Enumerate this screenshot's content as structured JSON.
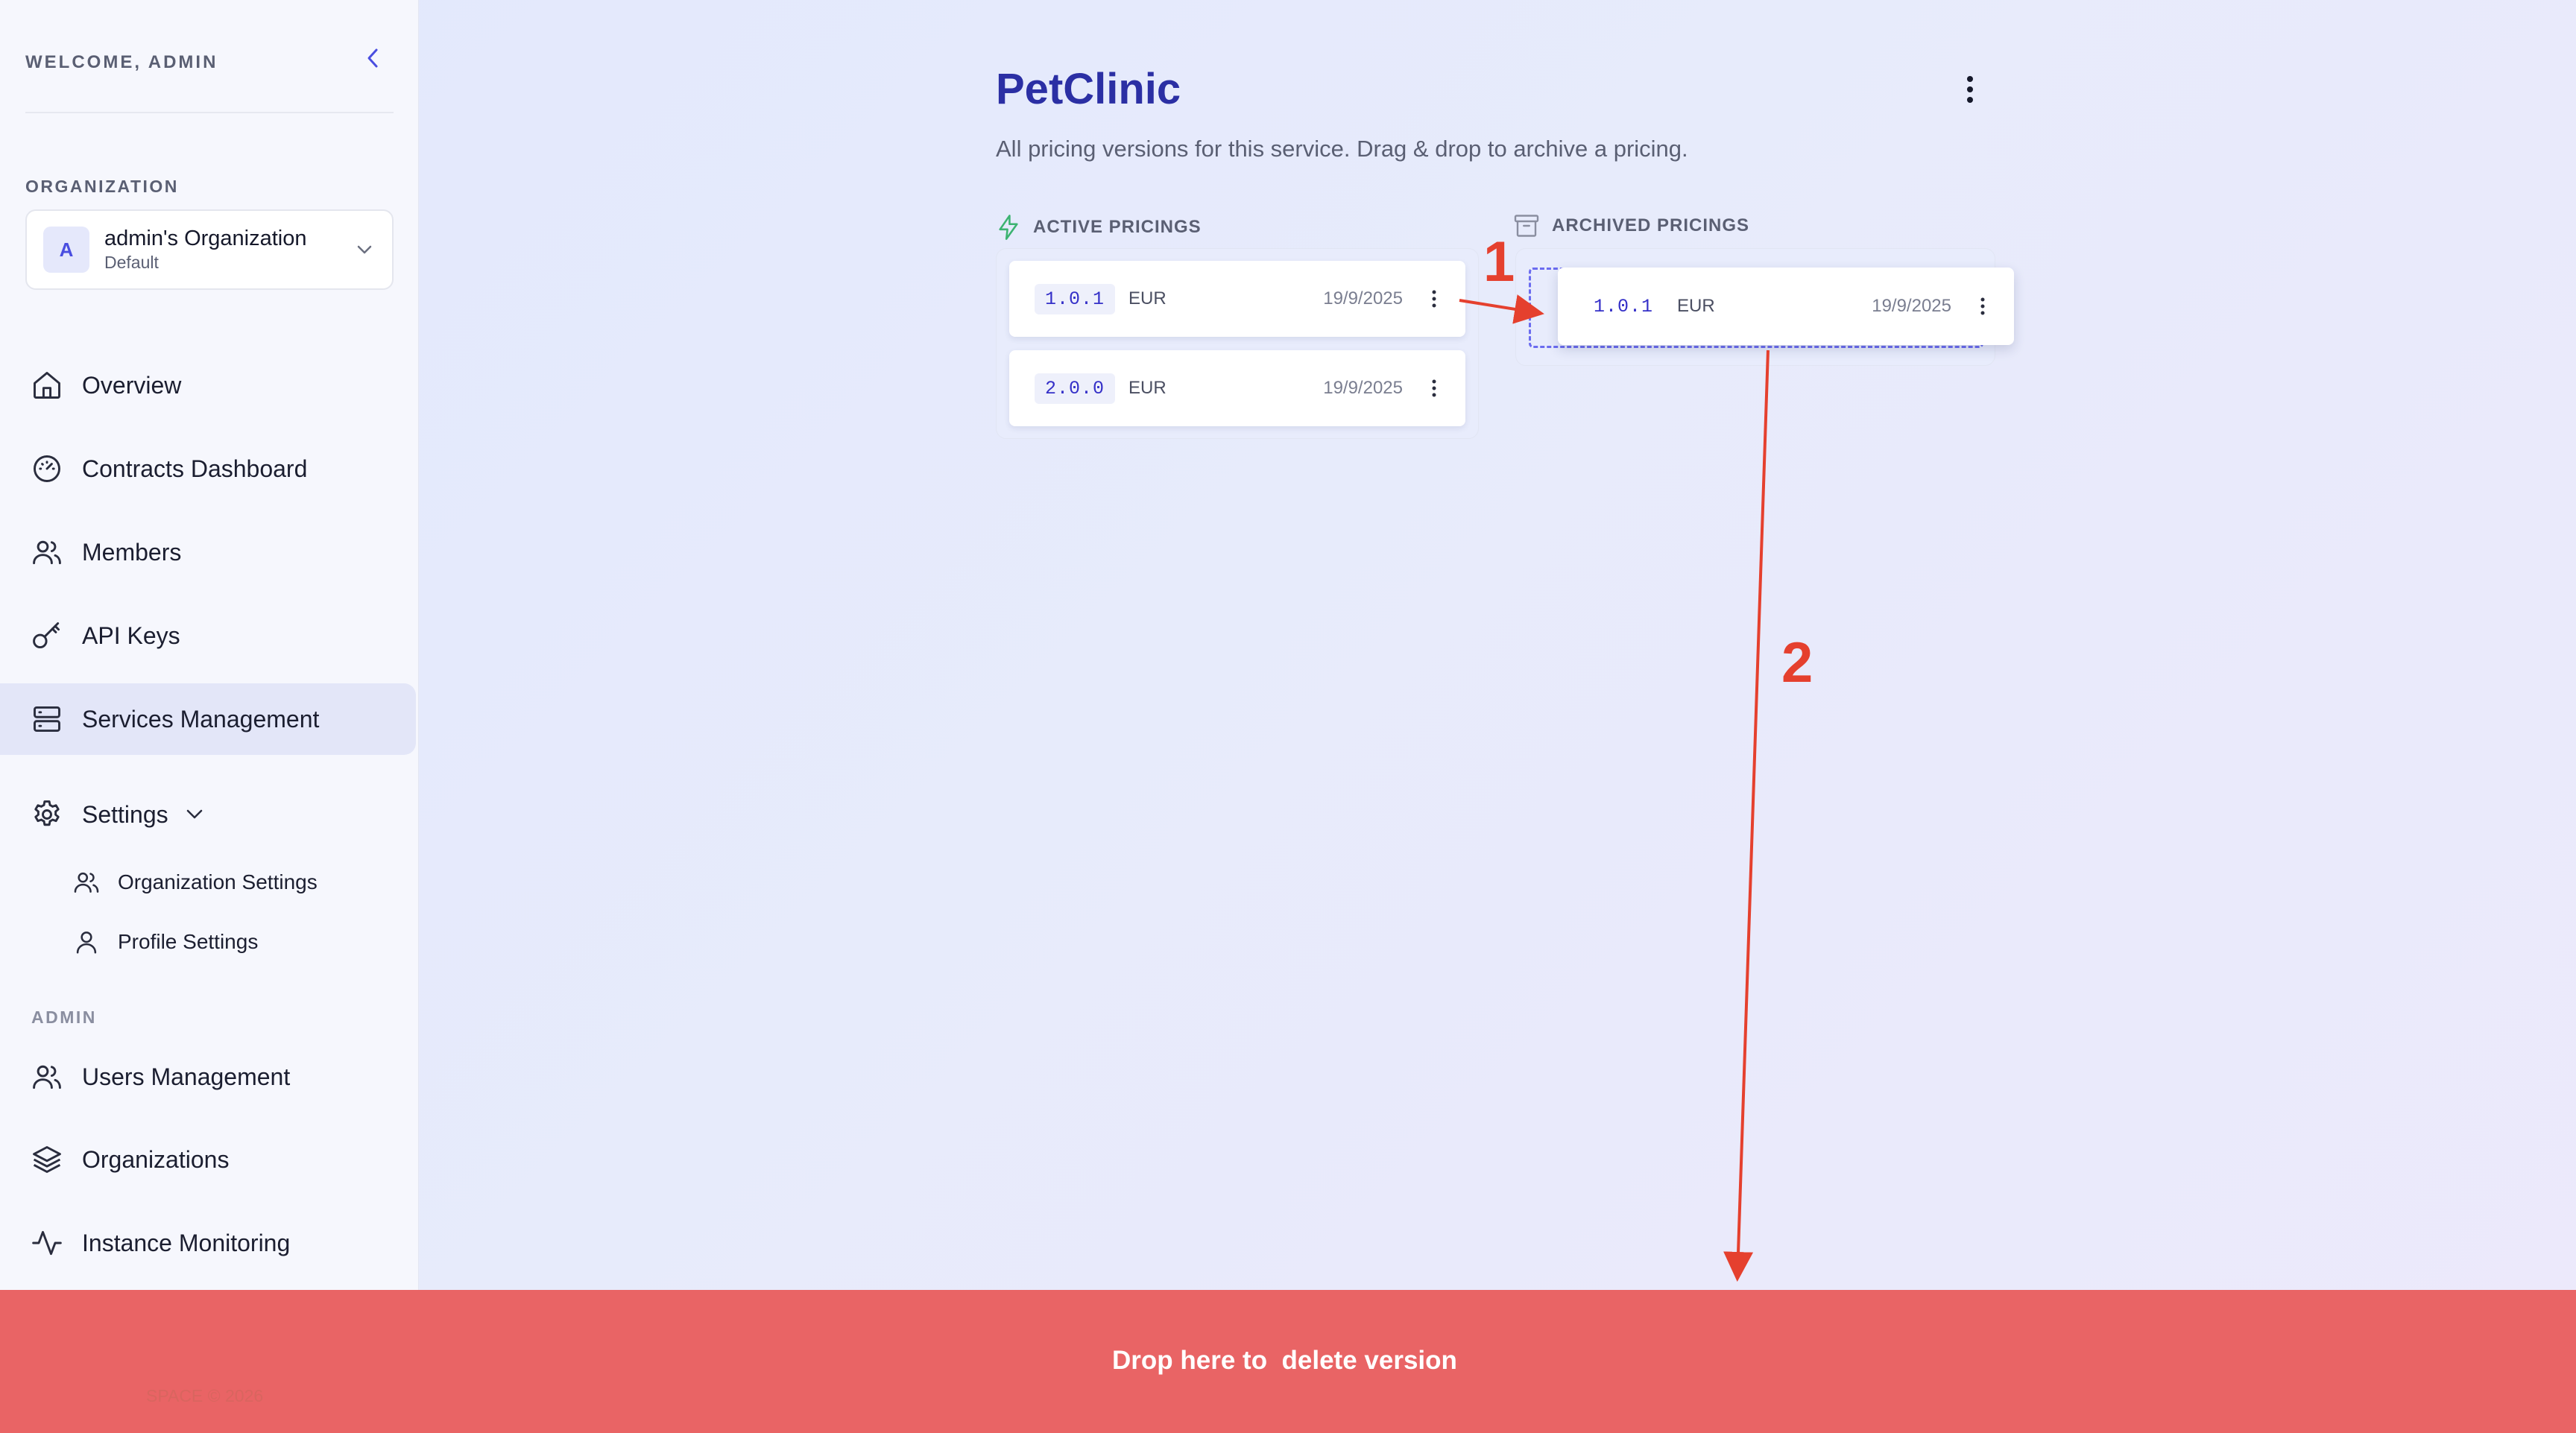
{
  "sidebar": {
    "welcome": "WELCOME, ADMIN",
    "organization_label": "ORGANIZATION",
    "organization": {
      "avatar": "A",
      "name": "admin's Organization",
      "subtitle": "Default"
    },
    "nav": [
      {
        "label": "Overview",
        "icon": "home-icon"
      },
      {
        "label": "Contracts Dashboard",
        "icon": "gauge-icon"
      },
      {
        "label": "Members",
        "icon": "users-icon"
      },
      {
        "label": "API Keys",
        "icon": "key-icon"
      },
      {
        "label": "Services Management",
        "icon": "server-icon",
        "active": true
      },
      {
        "label": "Settings",
        "icon": "gear-icon"
      }
    ],
    "settings_sub": [
      {
        "label": "Organization Settings",
        "icon": "users-icon"
      },
      {
        "label": "Profile Settings",
        "icon": "user-icon"
      }
    ],
    "admin_label": "ADMIN",
    "admin_nav": [
      {
        "label": "Users Management",
        "icon": "users-icon"
      },
      {
        "label": "Organizations",
        "icon": "layers-icon"
      },
      {
        "label": "Instance Monitoring",
        "icon": "activity-icon"
      }
    ],
    "footer": "SPACE © 2026"
  },
  "main": {
    "title": "PetClinic",
    "subtitle": "All pricing versions for this service. Drag & drop to archive a pricing.",
    "active_label": "ACTIVE PRICINGS",
    "archived_label": "ARCHIVED PRICINGS",
    "active_pricings": [
      {
        "version": "1.0.1",
        "currency": "EUR",
        "date": "19/9/2025"
      },
      {
        "version": "2.0.0",
        "currency": "EUR",
        "date": "19/9/2025"
      }
    ],
    "dragging_pricing": {
      "version": "1.0.1",
      "currency": "EUR",
      "date": "19/9/2025"
    },
    "delete_zone": "Drop here to  delete version"
  },
  "annotations": {
    "step1": "1",
    "step2": "2"
  },
  "colors": {
    "accent": "#2b2fa4",
    "annotation": "#e5402e",
    "delete_zone": "#e96465",
    "active_icon": "#3cb371"
  }
}
